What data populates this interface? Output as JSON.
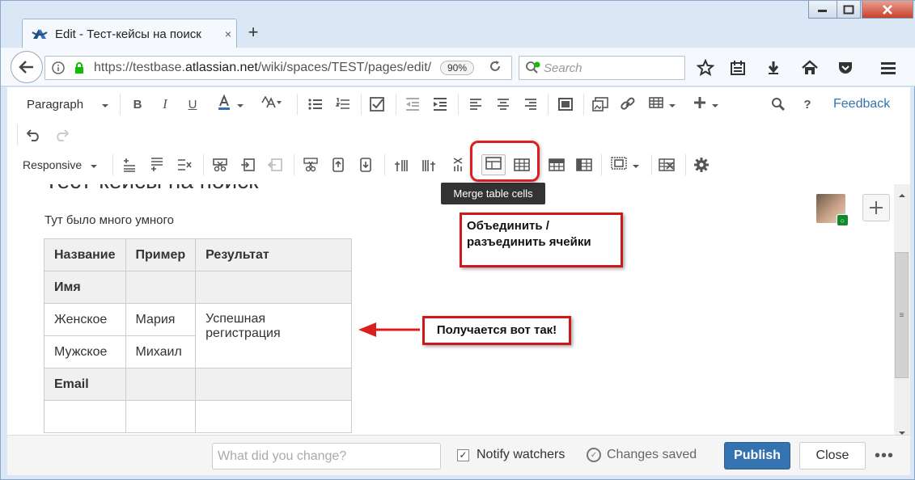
{
  "browser": {
    "tab_title": "Edit - Тест-кейсы на поиск",
    "tab_close": "×",
    "new_tab": "+",
    "url_prefix": "https://testbase.",
    "url_domain": "atlassian.net",
    "url_path": "/wiki/spaces/TEST/pages/edit/",
    "zoom": "90%",
    "search_placeholder": "Search"
  },
  "toolbar": {
    "paragraph": "Paragraph",
    "responsive": "Responsive",
    "feedback": "Feedback",
    "help": "?"
  },
  "tooltip": "Merge table cells",
  "page": {
    "title": "Тест-кейсы на поиск",
    "intro": "Тут было много умного",
    "table": {
      "headers": [
        "Название",
        "Пример",
        "Результат"
      ],
      "row_name": "Имя",
      "female": "Женское",
      "maria": "Мария",
      "result": "Успешная регистрация",
      "male": "Мужское",
      "mikhail": "Михаил",
      "email": "Email"
    }
  },
  "annotations": {
    "merge_note": "Объединить / разъединить ячейки",
    "result_note": "Получается вот так!"
  },
  "footer": {
    "change_placeholder": "What did you change?",
    "notify": "Notify watchers",
    "saved": "Changes saved",
    "publish": "Publish",
    "close": "Close",
    "more": "•••"
  },
  "colors": {
    "accent": "#3572b0",
    "annotation": "#cc1a1a"
  }
}
